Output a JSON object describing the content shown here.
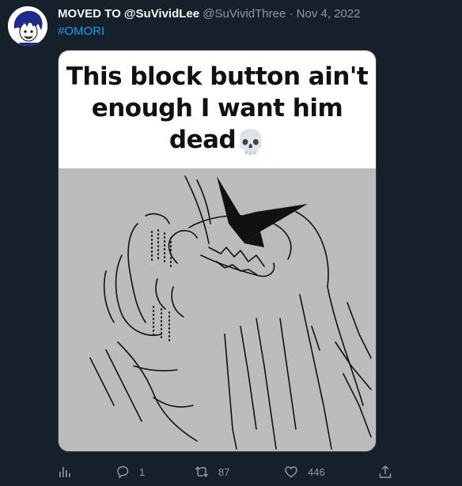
{
  "tweet": {
    "display_name": "MOVED TO @SuVividLee",
    "handle": "@SuVividThree",
    "separator": "·",
    "date": "Nov 4, 2022",
    "hashtag": "#OMORI"
  },
  "media": {
    "caption_line1": "This block button ain't",
    "caption_line2": "enough I want him",
    "caption_line3": "dead",
    "caption_emoji": "💀"
  },
  "actions": {
    "analytics_icon": "bar-chart-icon",
    "reply_icon": "reply-icon",
    "reply_count": "1",
    "retweet_icon": "retweet-icon",
    "retweet_count": "87",
    "like_icon": "heart-icon",
    "like_count": "446",
    "share_icon": "share-icon"
  },
  "colors": {
    "background": "#15202b",
    "text_primary": "#f7f9f9",
    "text_secondary": "#8b98a5",
    "link": "#1d9bf0"
  }
}
